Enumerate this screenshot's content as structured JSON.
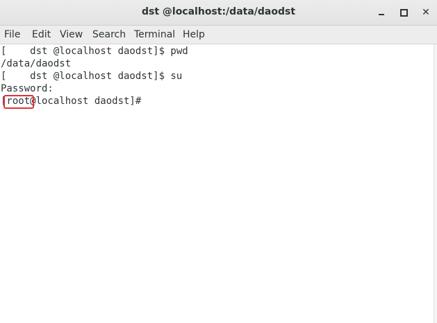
{
  "window": {
    "title": "dst @localhost:/data/daodst",
    "controls": {
      "minimize_icon": "minimize-icon",
      "maximize_icon": "maximize-icon",
      "close_icon": "close-icon",
      "close_glyph": "✕"
    }
  },
  "menubar": {
    "items": [
      "File",
      "Edit",
      "View",
      "Search",
      "Terminal",
      "Help"
    ]
  },
  "terminal": {
    "lines": [
      "[    dst @localhost daodst]$ pwd",
      "/data/daodst",
      "[    dst @localhost daodst]$ su",
      "Password:",
      "[root@localhost daodst]#"
    ]
  },
  "annotation": {
    "color": "#e0303a",
    "target": "root"
  }
}
